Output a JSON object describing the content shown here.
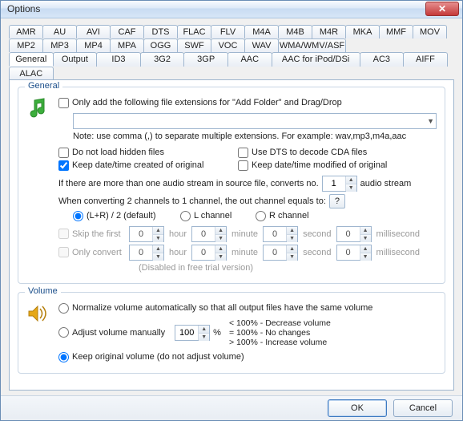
{
  "window": {
    "title": "Options"
  },
  "tabs_row1": [
    "AMR",
    "AU",
    "AVI",
    "CAF",
    "DTS",
    "FLAC",
    "FLV",
    "M4A",
    "M4B",
    "M4R",
    "MKA",
    "MMF",
    "MOV",
    "MP2",
    "MP3",
    "MP4",
    "MPA",
    "OGG",
    "SWF",
    "VOC",
    "WAV",
    "WMA/WMV/ASF"
  ],
  "tabs_row2": [
    "General",
    "Output",
    "ID3",
    "3G2",
    "3GP",
    "AAC",
    "AAC for iPod/DSi",
    "AC3",
    "AIFF",
    "ALAC"
  ],
  "active_tab": "General",
  "general": {
    "legend": "General",
    "only_add_label": "Only add the following file extensions for \"Add Folder\" and Drag/Drop",
    "only_add_checked": false,
    "ext_note": "Note: use comma (,) to separate multiple extensions. For example: wav,mp3,m4a,aac",
    "hidden_label": "Do not load hidden files",
    "hidden_checked": false,
    "dts_label": "Use DTS to decode CDA files",
    "dts_checked": false,
    "keep_created_label": "Keep date/time created of original",
    "keep_created_checked": true,
    "keep_modified_label": "Keep date/time modified of original",
    "keep_modified_checked": false,
    "multi_stream_prefix": "If there are more than one audio stream in source file, converts no.",
    "multi_stream_value": "1",
    "multi_stream_suffix": "audio stream",
    "downmix_label": "When converting 2 channels to 1 channel, the out channel equals to:",
    "downmix_help": "?",
    "downmix_options": {
      "lr": "(L+R) / 2 (default)",
      "l": "L channel",
      "r": "R channel"
    },
    "downmix_selected": "lr",
    "skip_label": "Skip the first",
    "only_convert_label": "Only convert",
    "time_units": {
      "hour": "hour",
      "minute": "minute",
      "second": "second",
      "millisecond": "millisecond"
    },
    "time_default": "0",
    "trial_note": "(Disabled in free trial version)"
  },
  "volume": {
    "legend": "Volume",
    "normalize_label": "Normalize volume automatically so that all output files have the same volume",
    "adjust_label": "Adjust volume manually",
    "adjust_value": "100",
    "adjust_percent": "%",
    "hints_lt": "< 100% - Decrease volume",
    "hints_eq": "= 100% - No changes",
    "hints_gt": "> 100% - Increase volume",
    "keep_label": "Keep original volume (do not adjust volume)",
    "selected": "keep"
  },
  "footer": {
    "ok": "OK",
    "cancel": "Cancel"
  }
}
